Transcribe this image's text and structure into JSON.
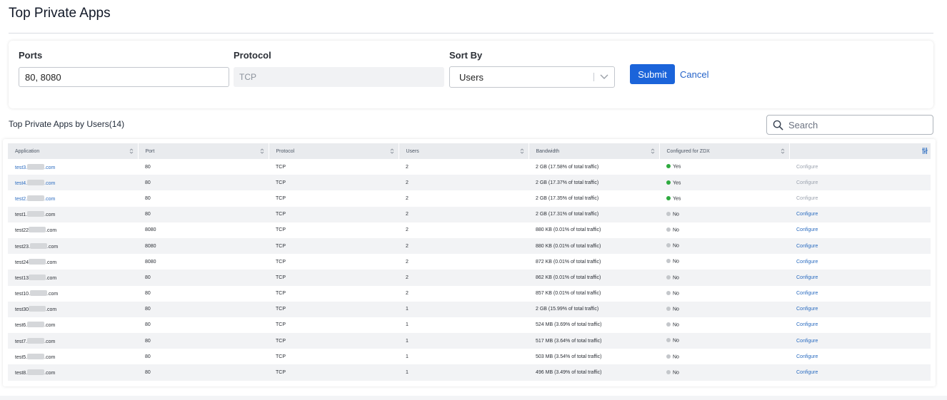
{
  "page": {
    "title": "Top Private Apps"
  },
  "filters": {
    "ports_label": "Ports",
    "ports_value": "80, 8080",
    "protocol_label": "Protocol",
    "protocol_value": "TCP",
    "sort_label": "Sort By",
    "sort_value": "Users",
    "submit_label": "Submit",
    "cancel_label": "Cancel"
  },
  "table": {
    "title": "Top Private Apps by Users",
    "count": "(14)",
    "search_placeholder": "Search",
    "columns": [
      "Application",
      "Port",
      "Protocol",
      "Users",
      "Bandwidth",
      "Configured for ZDX"
    ],
    "rows": [
      {
        "app_prefix": "test3.",
        "app_suffix": ".com",
        "port": "80",
        "protocol": "TCP",
        "users": "2",
        "bandwidth": "2 GB (17.58% of total traffic)",
        "configured": "Yes",
        "action": "Configure",
        "link": true
      },
      {
        "app_prefix": "test4.",
        "app_suffix": ".com",
        "port": "80",
        "protocol": "TCP",
        "users": "2",
        "bandwidth": "2 GB (17.37% of total traffic)",
        "configured": "Yes",
        "action": "Configure",
        "link": true
      },
      {
        "app_prefix": "test2.",
        "app_suffix": ".com",
        "port": "80",
        "protocol": "TCP",
        "users": "2",
        "bandwidth": "2 GB (17.35% of total traffic)",
        "configured": "Yes",
        "action": "Configure",
        "link": true
      },
      {
        "app_prefix": "test1.",
        "app_suffix": ".com",
        "port": "80",
        "protocol": "TCP",
        "users": "2",
        "bandwidth": "2 GB (17.31% of total traffic)",
        "configured": "No",
        "action": "Configure",
        "link": false
      },
      {
        "app_prefix": "test22",
        "app_suffix": ".com",
        "port": "8080",
        "protocol": "TCP",
        "users": "2",
        "bandwidth": "880 KB (0.01% of total traffic)",
        "configured": "No",
        "action": "Configure",
        "link": false
      },
      {
        "app_prefix": "test23.",
        "app_suffix": ".com",
        "port": "8080",
        "protocol": "TCP",
        "users": "2",
        "bandwidth": "880 KB (0.01% of total traffic)",
        "configured": "No",
        "action": "Configure",
        "link": false
      },
      {
        "app_prefix": "test24",
        "app_suffix": ".com",
        "port": "8080",
        "protocol": "TCP",
        "users": "2",
        "bandwidth": "872 KB (0.01% of total traffic)",
        "configured": "No",
        "action": "Configure",
        "link": false
      },
      {
        "app_prefix": "test13",
        "app_suffix": ".com",
        "port": "80",
        "protocol": "TCP",
        "users": "2",
        "bandwidth": "862 KB (0.01% of total traffic)",
        "configured": "No",
        "action": "Configure",
        "link": false
      },
      {
        "app_prefix": "test10.",
        "app_suffix": ".com",
        "port": "80",
        "protocol": "TCP",
        "users": "2",
        "bandwidth": "857 KB (0.01% of total traffic)",
        "configured": "No",
        "action": "Configure",
        "link": false
      },
      {
        "app_prefix": "test30",
        "app_suffix": ".com",
        "port": "80",
        "protocol": "TCP",
        "users": "1",
        "bandwidth": "2 GB (15.99% of total traffic)",
        "configured": "No",
        "action": "Configure",
        "link": false
      },
      {
        "app_prefix": "test6.",
        "app_suffix": ".com",
        "port": "80",
        "protocol": "TCP",
        "users": "1",
        "bandwidth": "524 MB (3.69% of total traffic)",
        "configured": "No",
        "action": "Configure",
        "link": false
      },
      {
        "app_prefix": "test7.",
        "app_suffix": ".com",
        "port": "80",
        "protocol": "TCP",
        "users": "1",
        "bandwidth": "517 MB (3.64% of total traffic)",
        "configured": "No",
        "action": "Configure",
        "link": false
      },
      {
        "app_prefix": "test5.",
        "app_suffix": ".com",
        "port": "80",
        "protocol": "TCP",
        "users": "1",
        "bandwidth": "503 MB (3.54% of total traffic)",
        "configured": "No",
        "action": "Configure",
        "link": false
      },
      {
        "app_prefix": "test8.",
        "app_suffix": ".com",
        "port": "80",
        "protocol": "TCP",
        "users": "1",
        "bandwidth": "496 MB (3.49% of total traffic)",
        "configured": "No",
        "action": "Configure",
        "link": false
      }
    ]
  },
  "colors": {
    "accent": "#1b64da",
    "link": "#2b6cc0",
    "yes": "#2eaa3f",
    "no": "#c4c7cb"
  },
  "icons": {
    "search": "search-icon",
    "sort": "sort-icon",
    "chevron": "chevron-down-icon",
    "columns": "column-settings-icon"
  }
}
